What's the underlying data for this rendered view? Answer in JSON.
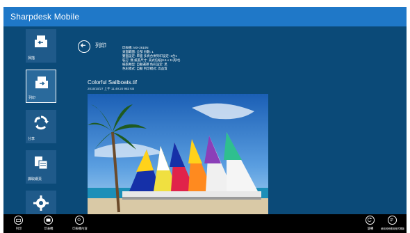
{
  "app": {
    "title": "Sharpdesk Mobile"
  },
  "sidebar": {
    "items": [
      {
        "label": "掃描",
        "icon": "scan-icon"
      },
      {
        "label": "列印",
        "icon": "print-icon"
      },
      {
        "label": "分享",
        "icon": "share-icon"
      },
      {
        "label": "擷取網頁",
        "icon": "capture-webpage-icon"
      },
      {
        "label": "",
        "icon": "settings-icon"
      }
    ]
  },
  "main": {
    "heading": "列印",
    "print_info": [
      "印表機: MX-2610N",
      "頁面範圍: 全部  份數: 1",
      "雙面設定: 單面  多頁合併列印設定: 1合1",
      "裝訂: 無  紙張尺寸: 美式信紙(8.5 x 11英吋)",
      "紙張類型: 自動選擇  色彩設定: 黑",
      "色彩模式: 自動  列印模式: 高品質"
    ],
    "file": {
      "name": "Colorful Sailboats.tif",
      "meta": "2015/10/27 上午 11:49:20 983 KB"
    }
  },
  "bottom_bar": {
    "left": [
      {
        "label": "列印",
        "icon": "print-icon"
      },
      {
        "label": "印表機",
        "icon": "printer-icon"
      },
      {
        "label": "印表機內容",
        "icon": "printer-properties-icon"
      }
    ],
    "right": [
      {
        "label": "旋轉",
        "icon": "rotate-icon"
      },
      {
        "label": "使用其他應用程式開啟",
        "icon": "open-with-icon"
      }
    ]
  },
  "colors": {
    "title_bar": "#1f78c8",
    "background": "#0b4a78",
    "bottom_bar": "#000000"
  }
}
